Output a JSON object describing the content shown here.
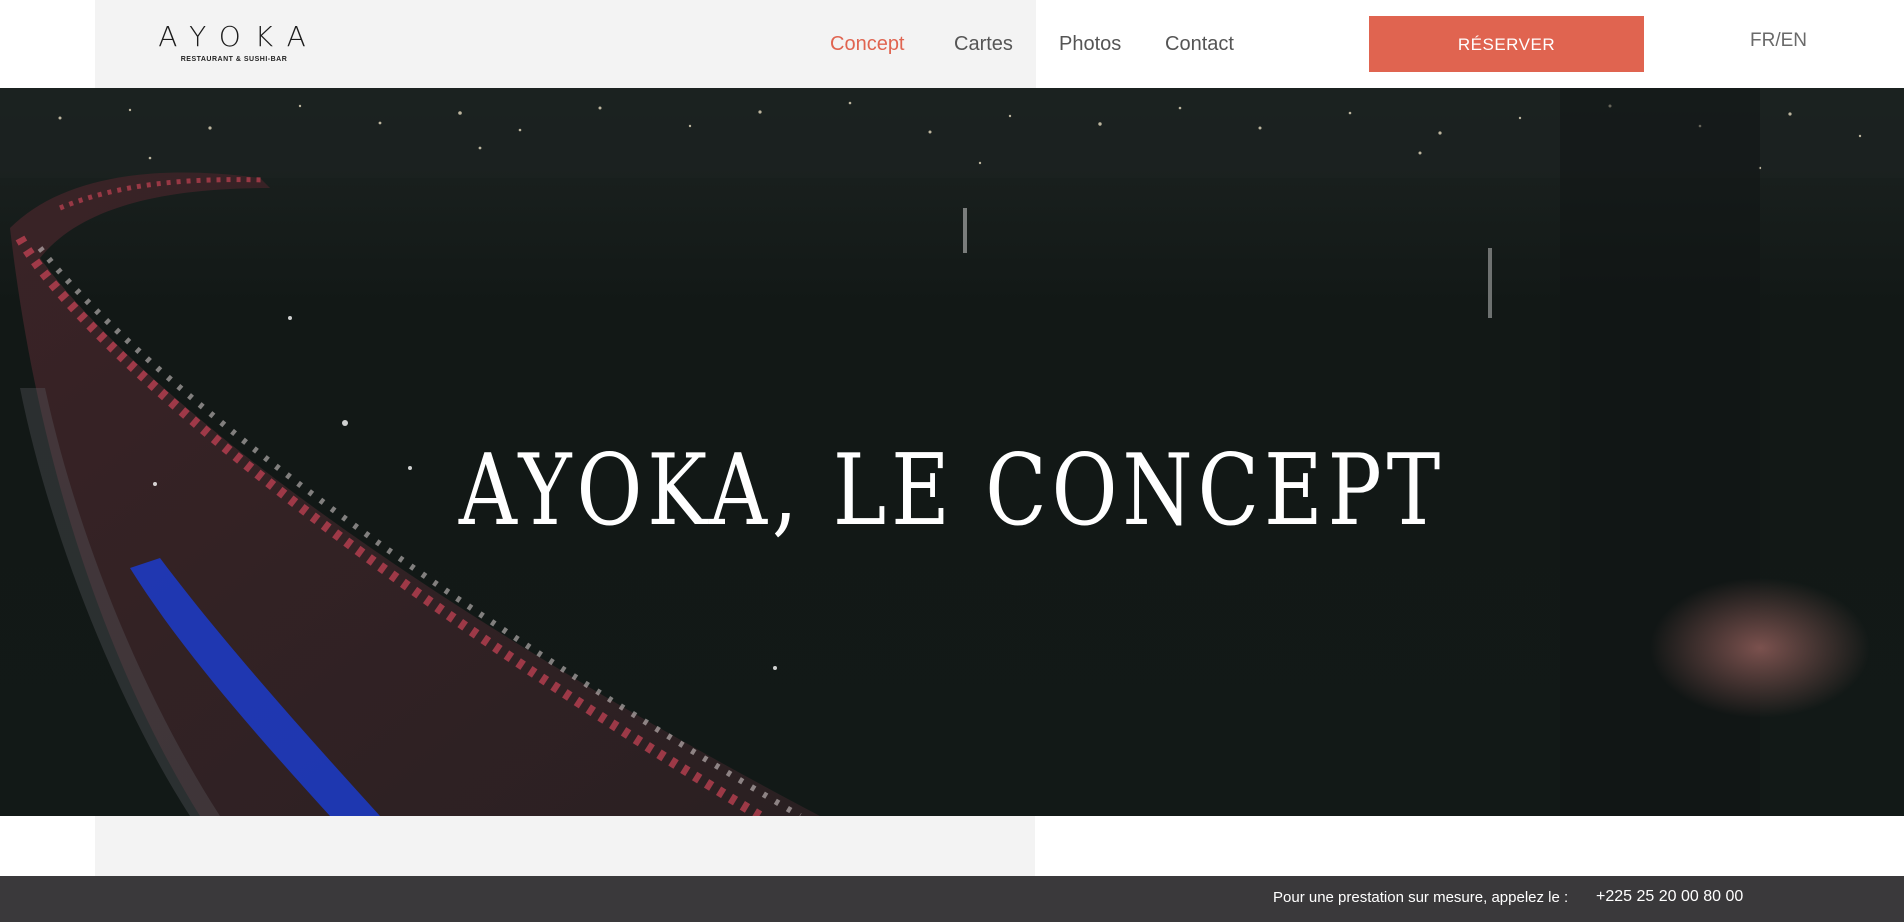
{
  "logo": {
    "wordmark": "AYOKA",
    "tagline": "RESTAURANT & SUSHI-BAR"
  },
  "nav": [
    {
      "label": "Concept",
      "active": true
    },
    {
      "label": "Cartes",
      "active": false
    },
    {
      "label": "Photos",
      "active": false
    },
    {
      "label": "Contact",
      "active": false
    }
  ],
  "reserve_button": "RÉSERVER",
  "language_switch": "FR/EN",
  "hero": {
    "title": "AYOKA, LE CONCEPT"
  },
  "footer": {
    "prompt": "Pour une prestation sur mesure, appelez le :",
    "phone": "+225 25 20 00 80 00"
  },
  "colors": {
    "accent": "#e06450",
    "footer_bg": "#3a393b",
    "header_gray": "#f3f3f3"
  }
}
